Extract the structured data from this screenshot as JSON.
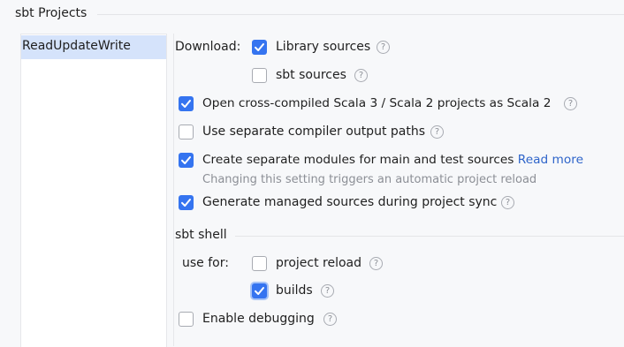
{
  "section_title": "sbt Projects",
  "projects": [
    "ReadUpdateWrite"
  ],
  "download": {
    "label": "Download:",
    "library_sources": {
      "label": "Library sources",
      "checked": true
    },
    "sbt_sources": {
      "label": "sbt sources",
      "checked": false
    }
  },
  "options": {
    "cross_compiled": {
      "label": "Open cross-compiled Scala 3 / Scala 2 projects as Scala 2",
      "checked": true
    },
    "separate_output": {
      "label": "Use separate compiler output paths",
      "checked": false
    },
    "separate_modules": {
      "label": "Create separate modules for main and test sources",
      "link": "Read more",
      "hint": "Changing this setting triggers an automatic project reload",
      "checked": true
    },
    "managed_sources": {
      "label": "Generate managed sources during project sync",
      "checked": true
    }
  },
  "sbt_shell": {
    "title": "sbt shell",
    "use_for_label": "use for:",
    "project_reload": {
      "label": "project reload",
      "checked": false
    },
    "builds": {
      "label": "builds",
      "checked": true
    },
    "enable_debugging": {
      "label": "Enable debugging",
      "checked": false
    }
  },
  "help_glyph": "?",
  "colors": {
    "accent": "#3574f0",
    "selection": "#d5e3fb",
    "link": "#2f65ca"
  }
}
